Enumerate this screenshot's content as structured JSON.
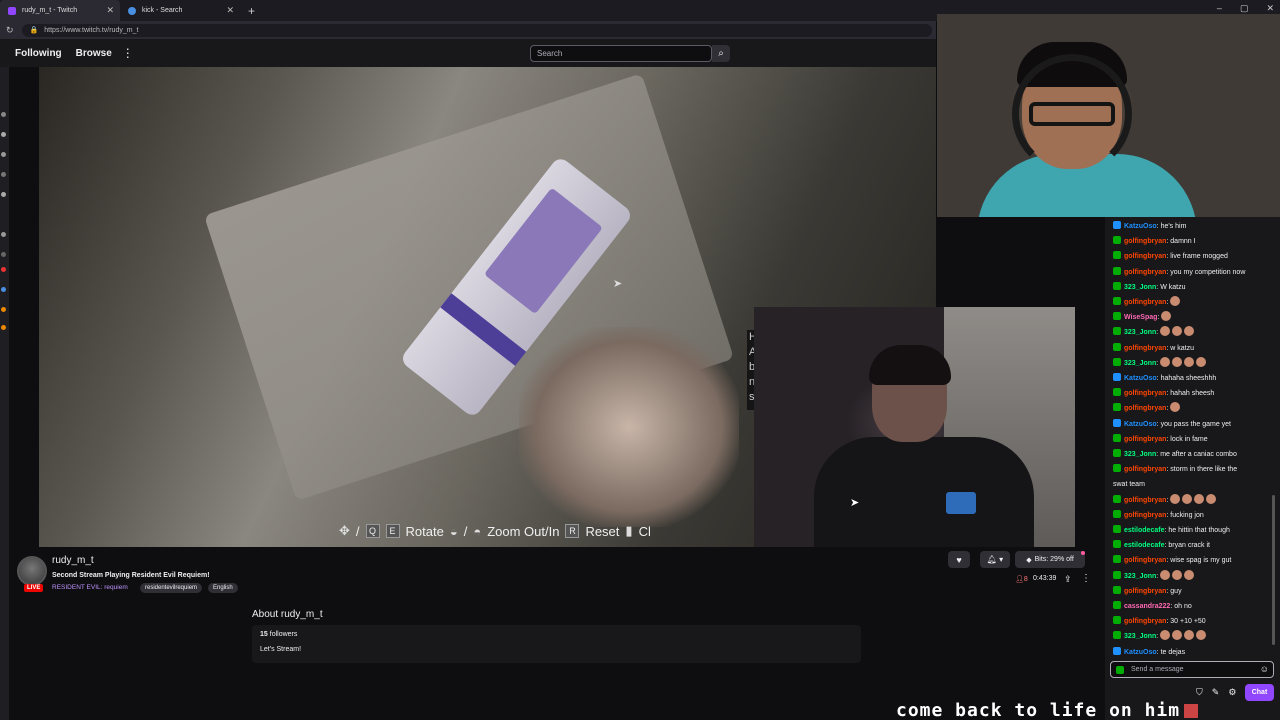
{
  "browser": {
    "tabs": [
      {
        "label": "rudy_m_t - Twitch",
        "active": true
      },
      {
        "label": "kick - Search",
        "active": false
      }
    ],
    "url": "https://www.twitch.tv/rudy_m_t",
    "new_tab": "+",
    "window_controls": [
      "–",
      "▢",
      "✕"
    ]
  },
  "nav": {
    "following": "Following",
    "browse": "Browse",
    "more": "⋮",
    "search_placeholder": "Search"
  },
  "game_hud": {
    "sep1": "/",
    "key_q": "Q",
    "key_e": "E",
    "rotate": "Rotate",
    "sep2": "/",
    "zoom": "Zoom Out/In",
    "key_r": "R",
    "reset": "Reset",
    "close_fragment": "Cl"
  },
  "side_text": "H\nA\nb\nn\ns",
  "stream": {
    "channel": "rudy_m_t",
    "title": "Second Stream Playing Resident Evil Requiem!",
    "game": "RESIDENT EVIL: requiem",
    "tags": [
      "residentevilrequiem",
      "English"
    ],
    "live": "LIVE",
    "viewers": "8",
    "uptime": "0:43:39",
    "bits": "Bits: 29% off"
  },
  "about": {
    "title": "About rudy_m_t",
    "followers_count": "15",
    "followers_label": "followers",
    "description": "Let's Stream!"
  },
  "chat": {
    "messages": [
      {
        "user": "KatzuOso",
        "text": "he's him",
        "color": "#1e90ff"
      },
      {
        "user": "golfingbryan",
        "text": "damnn I",
        "color": "#ff4500"
      },
      {
        "user": "golfingbryan",
        "text": "live frame mogged",
        "color": "#ff4500"
      },
      {
        "user": "golfingbryan",
        "text": "you my competition now",
        "color": "#ff4500"
      },
      {
        "user": "323_Jonn",
        "text": "W katzu",
        "color": "#00ff7f"
      },
      {
        "user": "golfingbryan",
        "text": "",
        "color": "#ff4500",
        "emotes": 1
      },
      {
        "user": "WiseSpag",
        "text": "",
        "color": "#ff69b4",
        "emotes": 1
      },
      {
        "user": "323_Jonn",
        "text": "",
        "color": "#00ff7f",
        "emotes": 3
      },
      {
        "user": "golfingbryan",
        "text": "w katzu",
        "color": "#ff4500"
      },
      {
        "user": "323_Jonn",
        "text": "",
        "color": "#00ff7f",
        "emotes": 4
      },
      {
        "user": "KatzuOso",
        "text": "hahaha sheeshhh",
        "color": "#1e90ff"
      },
      {
        "user": "golfingbryan",
        "text": "hahah sheesh",
        "color": "#ff4500"
      },
      {
        "user": "golfingbryan",
        "text": "",
        "color": "#ff4500",
        "emotes": 1
      },
      {
        "user": "KatzuOso",
        "text": "you pass the game yet",
        "color": "#1e90ff"
      },
      {
        "user": "golfingbryan",
        "text": "lock in fame",
        "color": "#ff4500"
      },
      {
        "user": "323_Jonn",
        "text": "me after a caniac combo",
        "color": "#00ff7f"
      },
      {
        "user": "golfingbryan",
        "text": "storm in there like the",
        "color": "#ff4500"
      },
      {
        "user": "",
        "text": "swat team",
        "color": "#efeff1"
      },
      {
        "user": "golfingbryan",
        "text": "",
        "color": "#ff4500",
        "emotes": 4
      },
      {
        "user": "golfingbryan",
        "text": "fucking jon",
        "color": "#ff4500"
      },
      {
        "user": "estilodecafe",
        "text": "he hittin that though",
        "color": "#00ff7f"
      },
      {
        "user": "estilodecafe",
        "text": "bryan crack it",
        "color": "#00ff7f"
      },
      {
        "user": "golfingbryan",
        "text": "wise spag is my gut",
        "color": "#ff4500"
      },
      {
        "user": "323_Jonn",
        "text": "",
        "color": "#00ff7f",
        "emotes": 3
      },
      {
        "user": "golfingbryan",
        "text": "guy",
        "color": "#ff4500"
      },
      {
        "user": "cassandra222",
        "text": "oh no",
        "color": "#ff69b4"
      },
      {
        "user": "golfingbryan",
        "text": "30 +10 +50",
        "color": "#ff4500"
      },
      {
        "user": "323_Jonn",
        "text": "",
        "color": "#00ff7f",
        "emotes": 4
      },
      {
        "user": "KatzuOso",
        "text": "te dejas",
        "color": "#1e90ff"
      }
    ],
    "input_placeholder": "Send a message",
    "chat_button": "Chat"
  },
  "overlay": {
    "bottom_text": "come back to life on him"
  },
  "colors": {
    "accent": "#9147ff",
    "live": "#eb0400",
    "game_link": "#bf94ff"
  }
}
